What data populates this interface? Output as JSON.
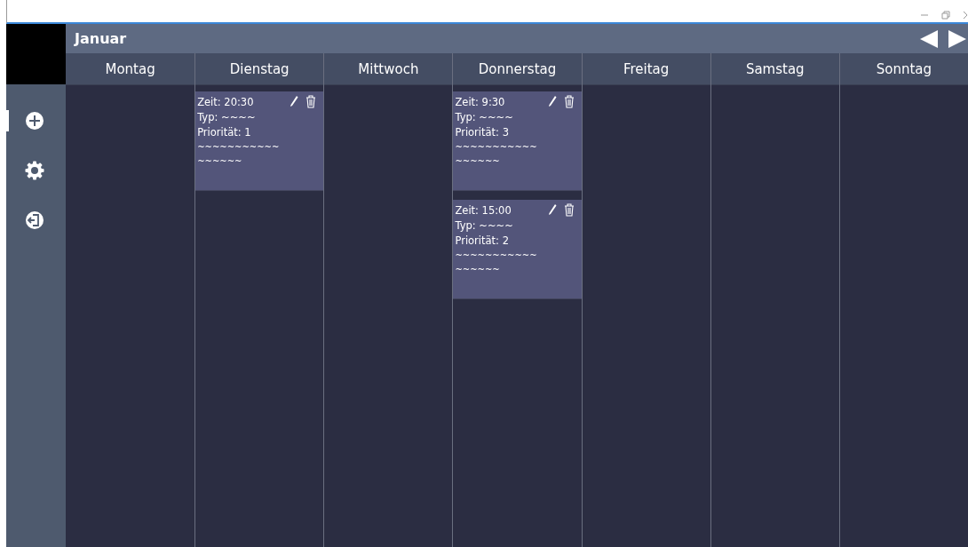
{
  "month": "Januar",
  "sidebar": [
    {
      "kind": "add",
      "selected": true
    },
    {
      "kind": "settings",
      "selected": false
    },
    {
      "kind": "exit",
      "selected": false
    }
  ],
  "days": [
    {
      "name": "Montag"
    },
    {
      "name": "Dienstag",
      "events": [
        {
          "time": "Zeit: 20:30",
          "type": "Typ: ~~~~",
          "priority": "Priorität: 1",
          "description": "~~~~~~~~~~~ ~~~~~~"
        }
      ]
    },
    {
      "name": "Mittwoch"
    },
    {
      "name": "Donnerstag",
      "events": [
        {
          "time": "Zeit: 9:30",
          "type": "Typ: ~~~~",
          "priority": "Priorität: 3",
          "description": "~~~~~~~~~~~ ~~~~~~"
        },
        {
          "time": "Zeit: 15:00",
          "type": "Typ: ~~~~",
          "priority": "Priorität: 2",
          "description": "~~~~~~~~~~~ ~~~~~~"
        }
      ]
    },
    {
      "name": "Freitag"
    },
    {
      "name": "Samstag"
    },
    {
      "name": "Sonntag"
    }
  ]
}
